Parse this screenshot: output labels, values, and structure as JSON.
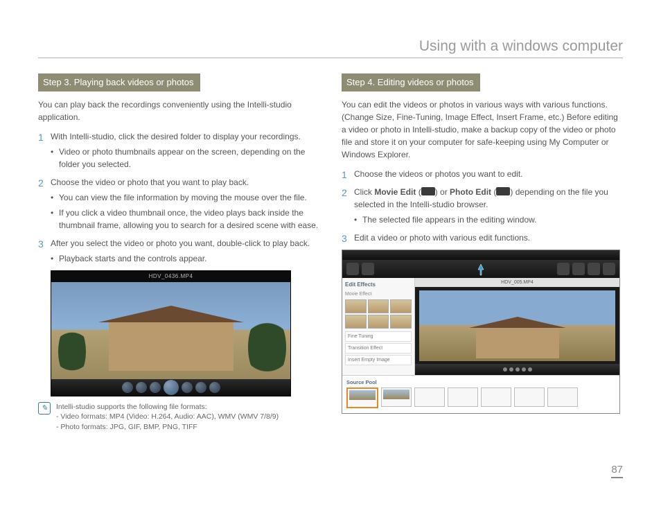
{
  "page": {
    "title": "Using with a windows computer",
    "number": "87"
  },
  "left": {
    "step_label": "Step 3. Playing back videos or photos",
    "intro": "You can play back the recordings conveniently using the Intelli-studio application.",
    "items": [
      {
        "num": "1",
        "text": "With Intelli-studio, click the desired folder to display your recordings.",
        "bullets": [
          "Video or photo thumbnails appear on the screen, depending on the folder you selected."
        ]
      },
      {
        "num": "2",
        "text": "Choose the video or photo that you want to play back.",
        "bullets": [
          "You can view the file information by moving the mouse over the file.",
          "If you click a video thumbnail once, the video plays back inside the thumbnail frame, allowing you to search for a desired scene with ease."
        ]
      },
      {
        "num": "3",
        "text": "After you select the video or photo you want, double-click to play back.",
        "bullets": [
          "Playback starts and the controls appear."
        ]
      }
    ],
    "player": {
      "title": "HDV_0436.MP4"
    },
    "note": {
      "line1": "Intelli-studio supports the following file formats:",
      "line2": "- Video formats: MP4 (Video: H.264, Audio: AAC), WMV (WMV 7/8/9)",
      "line3": "- Photo formats: JPG, GIF, BMP, PNG, TIFF"
    }
  },
  "right": {
    "step_label": "Step 4. Editing videos or photos",
    "intro": "You can edit the videos or photos in various ways with various functions. (Change Size, Fine-Tuning, Image Effect, Insert Frame, etc.) Before editing a video or photo in Intelli-studio, make a backup copy of the video or photo file and store it on your computer for safe-keeping using My Computer or Windows Explorer.",
    "items": [
      {
        "num": "1",
        "text": "Choose the videos or photos you want to edit.",
        "bullets": []
      },
      {
        "num": "2",
        "prefix": "Click ",
        "movie_edit": "Movie Edit",
        "mid1": " (",
        "mid2": ") or ",
        "photo_edit": "Photo Edit",
        "mid3": " (",
        "mid4": ") depending on the file you selected in the Intelli-studio browser.",
        "bullets": [
          "The selected file appears in the editing window."
        ]
      },
      {
        "num": "3",
        "text": "Edit a video or photo with various edit functions.",
        "bullets": []
      }
    ],
    "editor": {
      "side_title": "Edit Effects",
      "side_sub": "Movie Effect",
      "rows": [
        "Fine Tuning",
        "Transition Effect",
        "Insert Empty Image"
      ],
      "preview_tab": "HDV_005.MP4",
      "timeline_title": "Source Pool"
    }
  }
}
